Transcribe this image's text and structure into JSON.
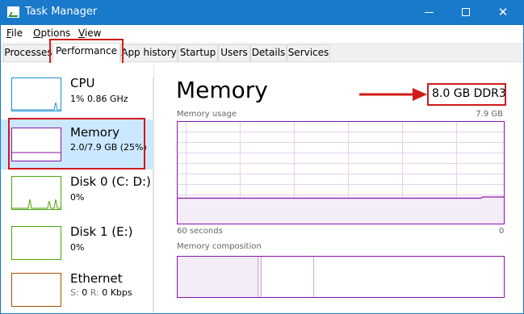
{
  "window": {
    "title": "Task Manager",
    "controls": {
      "minimize": "",
      "maximize": "",
      "close": "✕"
    }
  },
  "menu": [
    {
      "key": "F",
      "rest": "ile"
    },
    {
      "key": "O",
      "rest": "ptions"
    },
    {
      "key": "V",
      "rest": "iew"
    }
  ],
  "tabs": [
    {
      "label": "Processes"
    },
    {
      "label": "Performance",
      "active": true
    },
    {
      "label": "App history"
    },
    {
      "label": "Startup"
    },
    {
      "label": "Users"
    },
    {
      "label": "Details"
    },
    {
      "label": "Services"
    }
  ],
  "sidebar": {
    "items": [
      {
        "name": "CPU",
        "sub": "1% 0.86 GHz",
        "color": "#1a8fd4",
        "icon": "cpu-graph-icon"
      },
      {
        "name": "Memory",
        "sub": "2.0/7.9 GB (25%)",
        "color": "#8b12ae",
        "icon": "memory-graph-icon",
        "selected": true
      },
      {
        "name": "Disk 0 (C: D:)",
        "sub": "0%",
        "color": "#4da60c",
        "icon": "disk-graph-icon"
      },
      {
        "name": "Disk 1 (E:)",
        "sub": "0%",
        "color": "#4da60c",
        "icon": "disk-graph-icon"
      },
      {
        "name": "Ethernet",
        "sub_prefix_s": "S:",
        "sub_s": "0",
        "sub_prefix_r": "R:",
        "sub_r": "0 Kbps",
        "color": "#a74f01",
        "icon": "ethernet-graph-icon"
      }
    ]
  },
  "main": {
    "title": "Memory",
    "spec": "8.0 GB DDR3",
    "usage_label": "Memory usage",
    "usage_max": "7.9 GB",
    "time_left": "60 seconds",
    "time_right": "0",
    "composition_label": "Memory composition",
    "usage_fraction": 0.25
  },
  "colors": {
    "accent": "#1979ca",
    "memory": "#8b12ae",
    "annotation": "#d11a1a"
  }
}
